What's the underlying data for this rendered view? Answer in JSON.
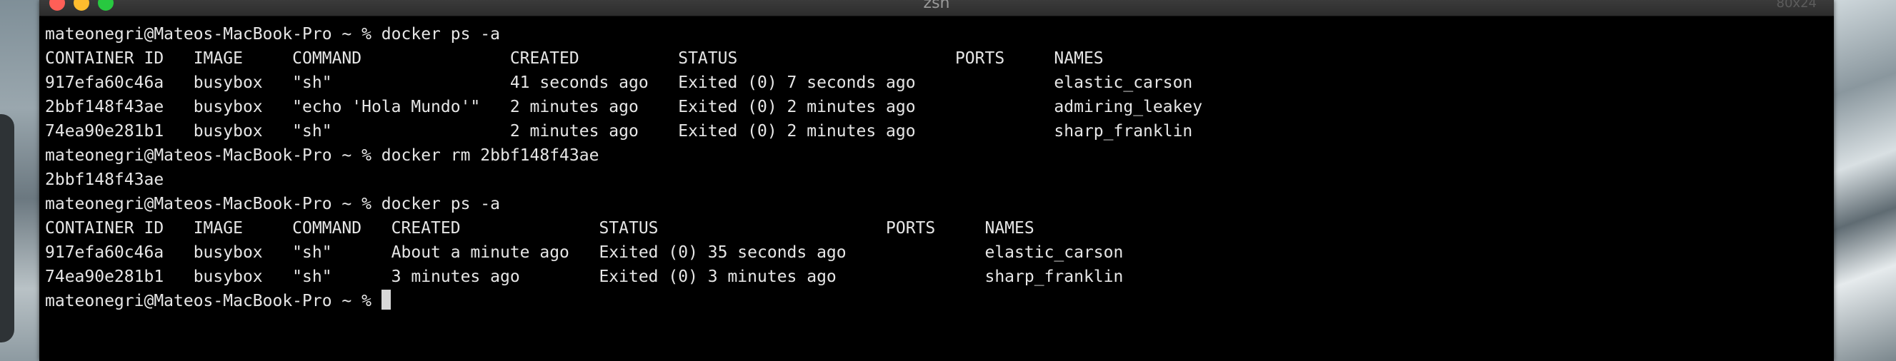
{
  "window": {
    "title": "zsh",
    "title_right": "80x24"
  },
  "terminal": {
    "lines": [
      "mateonegri@Mateos-MacBook-Pro ~ % docker ps -a",
      "CONTAINER ID   IMAGE     COMMAND               CREATED          STATUS                      PORTS     NAMES",
      "917efa60c46a   busybox   \"sh\"                  41 seconds ago   Exited (0) 7 seconds ago              elastic_carson",
      "2bbf148f43ae   busybox   \"echo 'Hola Mundo'\"   2 minutes ago    Exited (0) 2 minutes ago              admiring_leakey",
      "74ea90e281b1   busybox   \"sh\"                  2 minutes ago    Exited (0) 2 minutes ago              sharp_franklin",
      "mateonegri@Mateos-MacBook-Pro ~ % docker rm 2bbf148f43ae",
      "2bbf148f43ae",
      "mateonegri@Mateos-MacBook-Pro ~ % docker ps -a",
      "CONTAINER ID   IMAGE     COMMAND   CREATED              STATUS                       PORTS     NAMES",
      "917efa60c46a   busybox   \"sh\"      About a minute ago   Exited (0) 35 seconds ago              elastic_carson",
      "74ea90e281b1   busybox   \"sh\"      3 minutes ago        Exited (0) 3 minutes ago               sharp_franklin"
    ],
    "prompt": "mateonegri@Mateos-MacBook-Pro ~ % "
  }
}
